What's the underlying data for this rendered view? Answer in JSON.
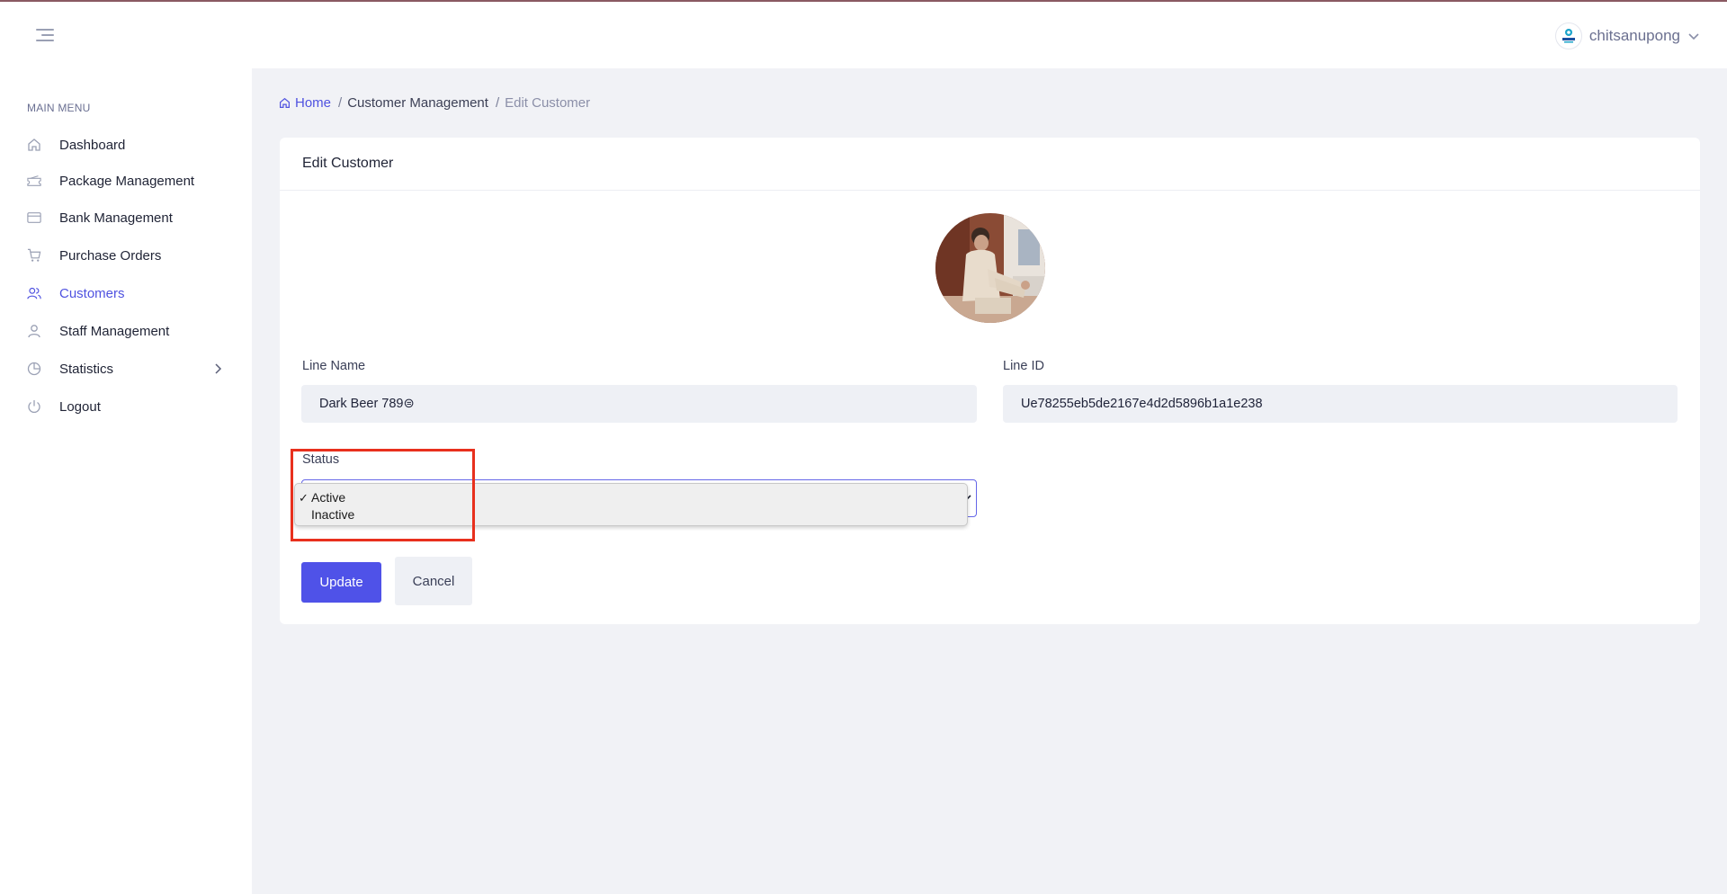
{
  "header": {
    "menu_toggle_icon": "hamburger-menu-icon",
    "user_avatar_icon": "brand-logo-icon",
    "username": "chitsanupong",
    "user_menu_icon": "chevron-down-icon"
  },
  "sidebar": {
    "title": "MAIN MENU",
    "items": [
      {
        "label": "Dashboard",
        "icon": "home-icon",
        "active": false
      },
      {
        "label": "Package Management",
        "icon": "ticket-icon",
        "active": false
      },
      {
        "label": "Bank Management",
        "icon": "credit-card-icon",
        "active": false
      },
      {
        "label": "Purchase Orders",
        "icon": "shopping-cart-icon",
        "active": false
      },
      {
        "label": "Customers",
        "icon": "users-icon",
        "active": true
      },
      {
        "label": "Staff Management",
        "icon": "user-icon",
        "active": false
      },
      {
        "label": "Statistics",
        "icon": "pie-chart-icon",
        "active": false,
        "has_submenu": true
      },
      {
        "label": "Logout",
        "icon": "power-icon",
        "active": false
      }
    ]
  },
  "breadcrumb": {
    "home": "Home",
    "section": "Customer Management",
    "current": "Edit Customer",
    "separator": "/"
  },
  "card": {
    "title": "Edit Customer",
    "profile_image": "customer-profile-photo",
    "line_name": {
      "label": "Line Name",
      "value": "Dark Beer 789⊜"
    },
    "line_id": {
      "label": "Line ID",
      "value": "Ue78255eb5de2167e4d2d5896b1a1e238"
    },
    "status": {
      "label": "Status",
      "selected": "Active",
      "options": [
        "Active",
        "Inactive"
      ],
      "check_mark": "✓"
    },
    "update_label": "Update",
    "cancel_label": "Cancel"
  },
  "colors": {
    "accent": "#4f52e8",
    "page_bg": "#f1f2f6",
    "highlight": "#e8301d"
  }
}
